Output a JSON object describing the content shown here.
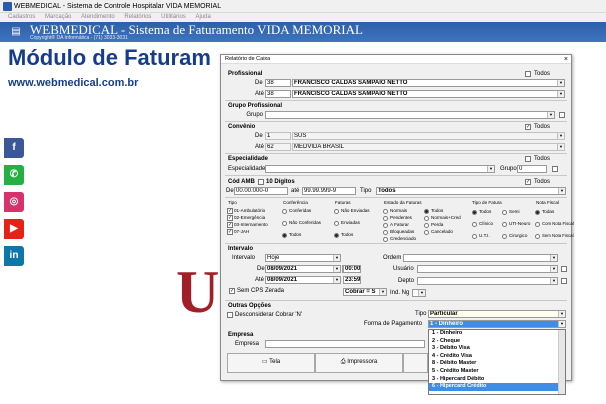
{
  "window": {
    "title": "WEBMEDICAL - Sistema de Controle Hospitalar VIDA MEMORIAL"
  },
  "menu": [
    "Cadastros",
    "Marcação",
    "Atendimento",
    "Relatórios",
    "Utilitários",
    "Ajuda"
  ],
  "banner": {
    "title": "WEBMEDICAL - Sistema de Faturamento VIDA MEMORIAL",
    "subtitle": "Copyright® DA Informática - (71) 3033-3031",
    "logo_icon": "building-icon"
  },
  "module_title": "Módulo de Faturam",
  "site_url": "www.webmedical.com.br",
  "social": [
    {
      "name": "facebook",
      "glyph": "f",
      "color": "#3b5998"
    },
    {
      "name": "whatsapp",
      "glyph": "✆",
      "color": "#25b043"
    },
    {
      "name": "instagram",
      "glyph": "◎",
      "color": "#d6336c"
    },
    {
      "name": "youtube",
      "glyph": "▶",
      "color": "#e62117"
    },
    {
      "name": "linkedin",
      "glyph": "in",
      "color": "#0e76a8"
    }
  ],
  "bg_letter": "U",
  "dialog": {
    "title": "Relatório de Caixa",
    "close": "×",
    "profissional": {
      "label": "Profissional",
      "todos": "Todos",
      "de_label": "De",
      "de_code": "38",
      "de_name": "FRANCISCO CALDAS SAMPAIO NETTO",
      "ate_label": "Até",
      "ate_code": "38",
      "ate_name": "FRANCISCO CALDAS SAMPAIO NETTO"
    },
    "grupo_prof": {
      "label": "Grupo Profissional",
      "grupo_label": "Grupo"
    },
    "convenio": {
      "label": "Convênio",
      "todos": "Todos",
      "de_label": "De",
      "de_code": "1",
      "de_name": "SUS",
      "ate_label": "Até",
      "ate_code": "62",
      "ate_name": "MEDVIDA BRASIL"
    },
    "especialidade": {
      "label": "Especialidade",
      "todos": "Todos",
      "field_label": "Especialidade",
      "grupo_label": "Grupo",
      "grupo_value": "0"
    },
    "cod_amb": {
      "label": "Cód AMB",
      "digits_label": "10 Dígitos",
      "todos": "Todos",
      "de_label": "De",
      "de_value": "00.00.000-0",
      "ate_label": "até",
      "ate_value": "99.99.999-9",
      "tipo_label": "Tipo",
      "tipo_value": "Todos"
    },
    "tipo": {
      "label": "Tipo",
      "items": [
        "01-Ambulatório",
        "02-Emergência",
        "03-Internamento",
        "07-JAH"
      ]
    },
    "conferencia": {
      "label": "Conferência",
      "items": [
        "Conferidas",
        "Não Conferidas",
        "Todos"
      ]
    },
    "faturas": {
      "label": "Faturas",
      "items": [
        "Não Enviadas",
        "Enviadas",
        "Todos"
      ]
    },
    "estado": {
      "label": "Estado da Faturas",
      "col1": [
        "Normais",
        "Pendentes",
        "A Faturar",
        "Bloqueadas",
        "Credenciado"
      ],
      "col2": [
        "Todos",
        "Normais+Cred",
        "Perda",
        "Cancelado"
      ]
    },
    "tipo_fatura": {
      "label": "Tipo de Fatura",
      "items": [
        "Todos",
        "Semi",
        "Clínico",
        "UTI-Neuro",
        "U.T.I.",
        "Cirurgico"
      ]
    },
    "nota_fiscal": {
      "label": "Nota Fiscal",
      "items": [
        "Todas",
        "Com Nota Fiscal",
        "Sem Nota Fiscal"
      ]
    },
    "intervalo": {
      "label": "Intervalo",
      "intervalo_label": "Intervalo",
      "intervalo_value": "Hoje",
      "de_label": "De",
      "de_date": "08/09/2021",
      "de_time": "00:00",
      "ate_label": "Até",
      "ate_date": "08/09/2021",
      "ate_time": "23:59",
      "sem_cps": "Sem CPS Zerada",
      "cobrar_value": "Cobrar = S"
    },
    "right_fields": {
      "ordem_label": "Ordem",
      "usuario_label": "Usuário",
      "depto_label": "Depto",
      "ind_ng_label": "Ind. Ng"
    },
    "outras": {
      "label": "Outras Opções",
      "desconsiderar": "Desconsiderar Cobrar 'N'",
      "tipo_label": "Tipo",
      "tipo_value": "Particular",
      "forma_label": "Forma de Pagamento",
      "forma_value": "1 - Dinheiro"
    },
    "empresa": {
      "label": "Empresa",
      "field_label": "Empresa"
    },
    "buttons": {
      "tela": "Tela",
      "impressora": "Impressora"
    },
    "dropdown_options": [
      "1 - Dinheiro",
      "2 - Cheque",
      "3 - Débito Visa",
      "4 - Crédito Visa",
      "8 - Débito Master",
      "5 - Crédito Master",
      "3 - Hipercard Débito",
      "6 - Hipercard Crédito"
    ]
  }
}
